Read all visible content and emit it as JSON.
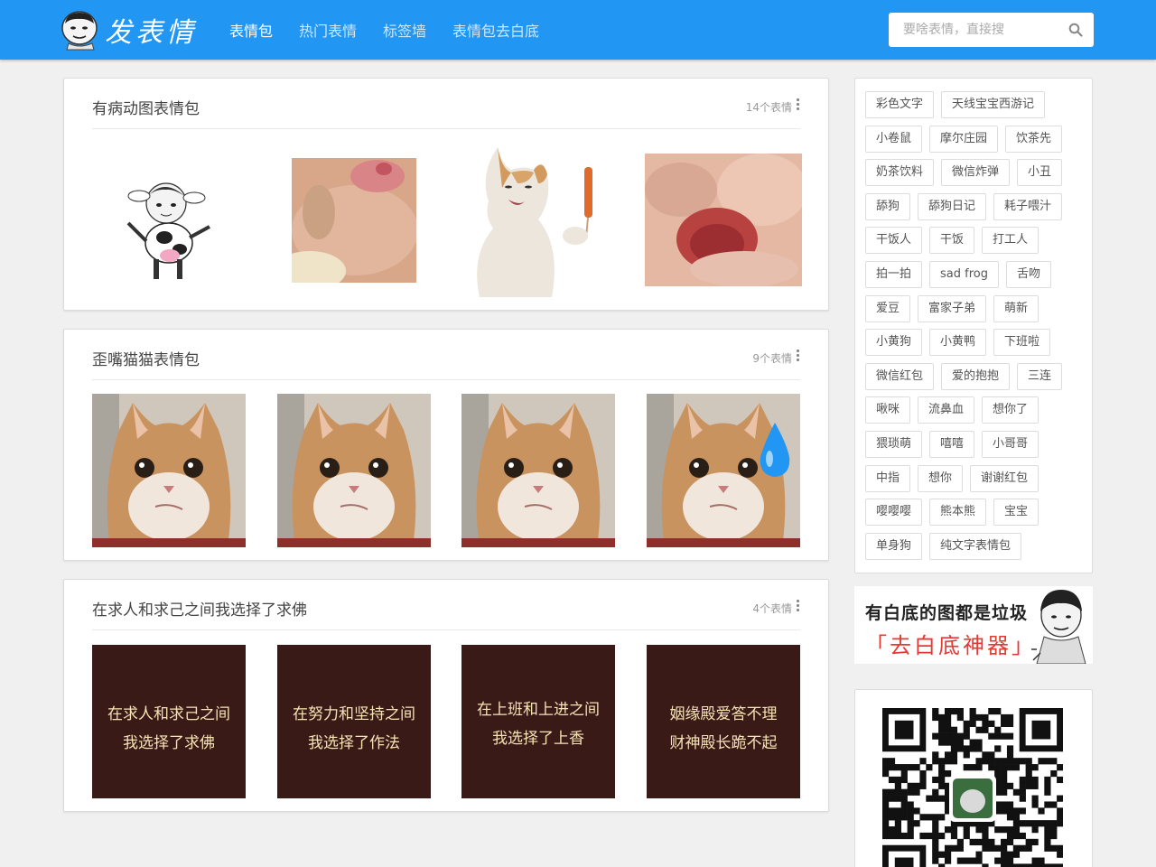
{
  "header": {
    "logo_text": "发表情",
    "nav": [
      "表情包",
      "热门表情",
      "标签墙",
      "表情包去白底"
    ],
    "active_nav": 0,
    "search_placeholder": "要啥表情，直接搜"
  },
  "albums": [
    {
      "title": "有病动图表情包",
      "count": "14个表情",
      "thumbs": [
        {
          "icon": "dancing-cow-sticker"
        },
        {
          "icon": "blurry-pet-closeup"
        },
        {
          "icon": "cat-holding-sausage"
        },
        {
          "icon": "pet-nose-closeup"
        }
      ]
    },
    {
      "title": "歪嘴猫猫表情包",
      "count": "9个表情",
      "thumbs": [
        {
          "icon": "smirking-cat"
        },
        {
          "icon": "smirking-cat"
        },
        {
          "icon": "smirking-cat"
        },
        {
          "icon": "smirking-cat-sweat-drop"
        }
      ]
    },
    {
      "title": "在求人和求己之间我选择了求佛",
      "count": "4个表情",
      "thumbs": [
        {
          "line1": "在求人和求己之间",
          "line2": "我选择了求佛"
        },
        {
          "line1": "在努力和坚持之间",
          "line2": "我选择了作法"
        },
        {
          "line1": "在上班和上进之间",
          "line2": "我选择了上香"
        },
        {
          "line1": "姻缘殿爱答不理",
          "line2": "财神殿长跪不起"
        }
      ]
    }
  ],
  "tags": [
    "彩色文字",
    "天线宝宝西游记",
    "小卷鼠",
    "摩尔庄园",
    "饮茶先",
    "奶茶饮料",
    "微信炸弹",
    "小丑",
    "舔狗",
    "舔狗日记",
    "耗子喂汁",
    "干饭人",
    "干饭",
    "打工人",
    "拍一拍",
    "sad frog",
    "舌吻",
    "爱豆",
    "富家子弟",
    "萌新",
    "小黄狗",
    "小黄鸭",
    "下班啦",
    "微信红包",
    "爱的抱抱",
    "三连",
    "啾咪",
    "流鼻血",
    "想你了",
    "猥琐萌",
    "嘻嘻",
    "小哥哥",
    "中指",
    "想你",
    "谢谢红包",
    "嘤嘤嘤",
    "熊本熊",
    "宝宝",
    "单身狗",
    "纯文字表情包"
  ],
  "banner": {
    "line1": "有白底的图都是垃圾",
    "line2": "「去白底神器」"
  },
  "colors": {
    "header_bg": "#2196f3",
    "text_card_bg": "#3a1a17",
    "text_card_fg": "#f6e3b4",
    "banner_red": "#e53935"
  }
}
